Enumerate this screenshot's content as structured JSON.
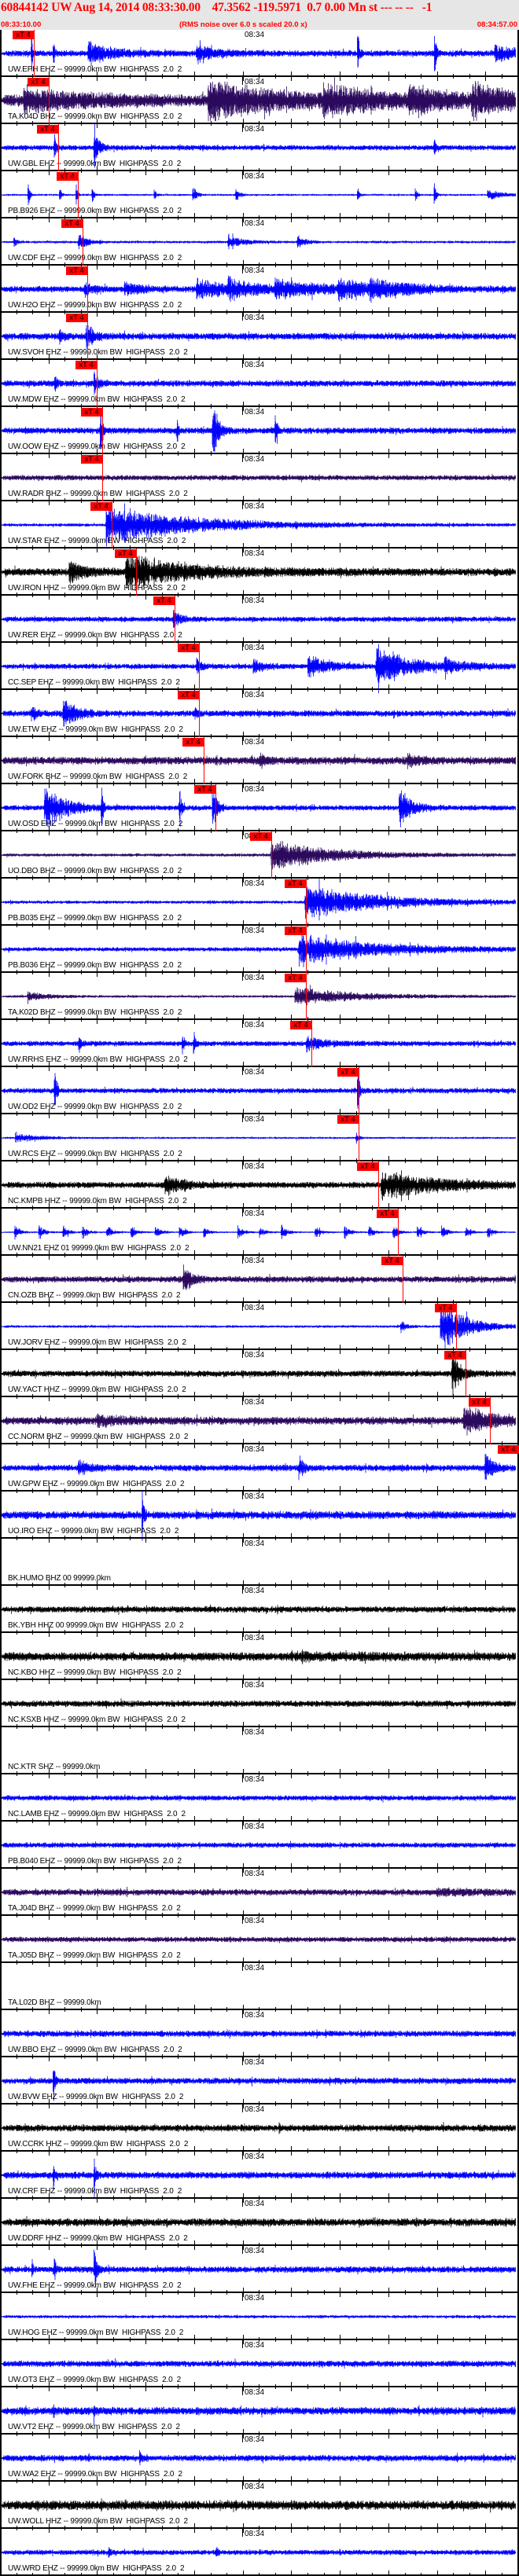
{
  "header": {
    "title": "60844142 UW Aug 14, 2014 08:33:30.00    47.3562 -119.5971  0.7 0.00 Mn st --- -- --   -1",
    "start_time": "08:33:10.00",
    "note": "(RMS noise over 6.0 s scaled 20.0 x)",
    "end_time": "08:34:57.00"
  },
  "axis": {
    "minute_label": "08:34",
    "minute_offset_s": 50
  },
  "palette": {
    "blue": "#0000ff",
    "purple": "#2b0a5e",
    "black": "#000000",
    "pick": "#ff0000"
  },
  "traces": [
    {
      "label": "UW.EPH EHZ -- 99999.0km BW  HIGHPASS  2.0  2",
      "color": "blue",
      "noise": 0.12,
      "pick": {
        "label": "xT 4",
        "time_s": 7.0
      },
      "bursts": [
        [
          6.5,
          1.2,
          0.2
        ],
        [
          11,
          1.2,
          0.2
        ],
        [
          18.2,
          0.5,
          5
        ],
        [
          40.5,
          0.4,
          4
        ],
        [
          73.7,
          1.3,
          0.3
        ],
        [
          89.6,
          1.3,
          0.3
        ],
        [
          102,
          0.4,
          4
        ]
      ]
    },
    {
      "label": "TA.K04D BHZ -- 99999.0km BW  HIGHPASS  2.0  2",
      "color": "purple",
      "noise": 0.22,
      "pick": {
        "label": "xT 4",
        "time_s": 10.0
      },
      "bursts": [
        [
          4.9,
          0.5,
          12
        ],
        [
          42.9,
          0.8,
          15
        ],
        [
          66.5,
          0.5,
          12
        ],
        [
          84.3,
          0.5,
          8
        ],
        [
          97.2,
          0.6,
          8
        ]
      ]
    },
    {
      "label": "UW.GBL EHZ -- 99999.0km BW  HIGHPASS  2.0  2",
      "color": "blue",
      "noise": 0.1,
      "pick": {
        "label": "xT 4",
        "time_s": 12.0
      },
      "bursts": [
        [
          11.2,
          0.8,
          0.4
        ],
        [
          19.4,
          1.3,
          0.8
        ],
        [
          89.5,
          0.4,
          0.3
        ]
      ]
    },
    {
      "label": "PB.B926 EHZ -- 99999.0km BW  HIGHPASS  2.0  2",
      "color": "blue",
      "noise": 0.04,
      "pick": {
        "label": "xT 4",
        "time_s": 16.0
      },
      "bursts": [
        [
          5.8,
          0.7,
          0.3
        ],
        [
          12.3,
          0.5,
          0.3
        ],
        [
          15.7,
          0.7,
          0.3
        ],
        [
          19,
          0.6,
          0.3
        ],
        [
          31.8,
          0.4,
          0.3
        ],
        [
          39.7,
          0.4,
          0.8
        ],
        [
          48.6,
          0.3,
          0.8
        ],
        [
          73.7,
          0.4,
          0.3
        ],
        [
          85.6,
          0.5,
          0.3
        ],
        [
          89.5,
          0.8,
          0.3
        ],
        [
          100.5,
          0.25,
          3
        ]
      ]
    },
    {
      "label": "UW.CDF EHZ -- 99999.0km BW  HIGHPASS  2.0  2",
      "color": "blue",
      "noise": 0.05,
      "pick": {
        "label": "xT 4",
        "time_s": 17.0
      },
      "bursts": [
        [
          2.9,
          0.4,
          0.4
        ],
        [
          16.2,
          0.5,
          1.5
        ],
        [
          47,
          0.3,
          3
        ],
        [
          61.3,
          0.3,
          1.5
        ]
      ]
    },
    {
      "label": "UW.H2O EHZ -- 99999.0km BW  HIGHPASS  2.0  2",
      "color": "blue",
      "noise": 0.12,
      "pick": {
        "label": "xT 4",
        "time_s": 18.0
      },
      "bursts": [
        [
          17.5,
          0.35,
          1.5
        ],
        [
          25.6,
          0.3,
          3
        ],
        [
          40.5,
          0.4,
          8
        ],
        [
          47,
          0.35,
          5
        ],
        [
          56.7,
          0.35,
          10
        ],
        [
          69.7,
          0.35,
          8
        ],
        [
          76.2,
          0.3,
          8
        ]
      ]
    },
    {
      "label": "UW.SVOH EHZ -- 99999.0km BW  HIGHPASS  2.0  2",
      "color": "blue",
      "noise": 0.13,
      "pick": {
        "label": "xT 4",
        "time_s": 18.0
      },
      "bursts": [
        [
          12.2,
          0.3,
          1
        ],
        [
          17.8,
          0.6,
          1.5
        ]
      ]
    },
    {
      "label": "UW.MDW EHZ -- 99999.0km BW  HIGHPASS  2.0  2",
      "color": "blue",
      "noise": 0.12,
      "pick": {
        "label": "xT 4",
        "time_s": 19.9
      },
      "bursts": [
        [
          11.3,
          0.5,
          0.4
        ],
        [
          19.4,
          0.6,
          0.8
        ]
      ]
    },
    {
      "label": "UW.OOW EHZ -- 99999.0km BW  HIGHPASS  2.0  2",
      "color": "blue",
      "noise": 0.12,
      "pick": {
        "label": "xT 4",
        "time_s": 21.1
      },
      "bursts": [
        [
          20.7,
          1.3,
          0.4
        ],
        [
          36.5,
          0.6,
          0.3
        ],
        [
          43.8,
          1.3,
          1.2
        ],
        [
          56.7,
          0.8,
          0.4
        ]
      ]
    },
    {
      "label": "UW.RADR BHZ -- 99999.0km BW  HIGHPASS  2.0  2",
      "color": "purple",
      "noise": 0.1,
      "pick": {
        "label": "xT 4",
        "time_s": 21.1
      },
      "bursts": []
    },
    {
      "label": "UW.STAR EHZ -- 99999.0km BW  HIGHPASS  2.0  2",
      "color": "blue",
      "noise": 0.06,
      "pick": {
        "label": "xT 4",
        "time_s": 23.0
      },
      "bursts": [
        [
          21.9,
          0.9,
          18
        ]
      ]
    },
    {
      "label": "UW.IRON HHZ -- 99999.0km BW  HIGHPASS  2.0  2",
      "color": "black",
      "noise": 0.15,
      "pick": {
        "label": "xT 4",
        "time_s": 28.0
      },
      "bursts": [
        [
          14.3,
          0.5,
          3
        ],
        [
          25.9,
          0.8,
          12
        ]
      ]
    },
    {
      "label": "UW.RER EHZ -- 99999.0km BW  HIGHPASS  2.0  2",
      "color": "blue",
      "noise": 0.1,
      "pick": {
        "label": "xT 4",
        "time_s": 36.0
      },
      "bursts": [
        [
          35.7,
          0.4,
          1.5
        ]
      ]
    },
    {
      "label": "CC.SEP EHZ -- 99999.0km BW  HIGHPASS  2.0  2",
      "color": "blue",
      "noise": 0.1,
      "pick": {
        "label": "xT 4",
        "time_s": 41.0
      },
      "bursts": [
        [
          40.5,
          0.4,
          1
        ],
        [
          52.2,
          0.3,
          2
        ],
        [
          63.5,
          0.5,
          4
        ],
        [
          77.5,
          1.0,
          6
        ],
        [
          91.6,
          0.3,
          4
        ]
      ]
    },
    {
      "label": "UW.ETW EHZ -- 99999.0km BW  HIGHPASS  2.0  2",
      "color": "blue",
      "noise": 0.12,
      "pick": {
        "label": "xT 4",
        "time_s": 41.0
      },
      "bursts": [
        [
          6.5,
          0.4,
          1
        ],
        [
          13,
          0.7,
          2.5
        ],
        [
          40.2,
          0.3,
          0.5
        ]
      ]
    },
    {
      "label": "UW.FORK BHZ -- 99999.0km BW  HIGHPASS  2.0  2",
      "color": "purple",
      "noise": 0.15,
      "pick": {
        "label": "xT 4",
        "time_s": 42.0
      },
      "bursts": [
        [
          53.5,
          0.3,
          1
        ],
        [
          84,
          0.3,
          2
        ]
      ]
    },
    {
      "label": "UW.OSD EHZ -- 99999.0km BW  HIGHPASS  2.0  2",
      "color": "blue",
      "noise": 0.1,
      "pick": {
        "label": "xT 4",
        "time_s": 44.4
      },
      "bursts": [
        [
          9.2,
          1.0,
          4
        ],
        [
          20.9,
          1.3,
          0.3
        ],
        [
          37,
          1.3,
          0.3
        ],
        [
          43.8,
          1.3,
          0.8
        ],
        [
          82.3,
          0.9,
          2.5
        ]
      ]
    },
    {
      "label": "UO.DBO BHZ -- 99999.0km BW  HIGHPASS  2.0  2",
      "color": "purple",
      "noise": 0.06,
      "pick": {
        "label": "xT 4",
        "time_s": 55.9
      },
      "bursts": [
        [
          55.9,
          0.7,
          12
        ]
      ]
    },
    {
      "label": "PB.B035 EHZ -- 99999.0km BW  HIGHPASS  2.0  2",
      "color": "blue",
      "noise": 0.06,
      "pick": {
        "label": "xT 4",
        "time_s": 63.0
      },
      "bursts": [
        [
          62.9,
          0.8,
          15
        ]
      ]
    },
    {
      "label": "PB.B036 EHZ -- 99999.0km BW  HIGHPASS  2.0  2",
      "color": "blue",
      "noise": 0.08,
      "pick": {
        "label": "xT 4",
        "time_s": 63.0
      },
      "bursts": [
        [
          61.6,
          0.7,
          15
        ]
      ]
    },
    {
      "label": "TA.K02D BHZ -- 99999.0km BW  HIGHPASS  2.0  2",
      "color": "purple",
      "noise": 0.05,
      "pick": {
        "label": "xT 4",
        "time_s": 63.0
      },
      "bursts": [
        [
          5.7,
          0.2,
          4
        ],
        [
          60.8,
          0.4,
          12
        ]
      ]
    },
    {
      "label": "UW.RRHS EHZ -- 99999.0km BW  HIGHPASS  2.0  2",
      "color": "blue",
      "noise": 0.1,
      "pick": {
        "label": "xT 4",
        "time_s": 64.2
      },
      "bursts": [
        [
          16.2,
          0.6,
          0.4
        ],
        [
          37.6,
          0.8,
          0.3
        ],
        [
          39.9,
          0.8,
          0.3
        ],
        [
          63.2,
          0.3,
          4
        ]
      ]
    },
    {
      "label": "UW.OD2 EHZ -- 99999.0km BW  HIGHPASS  2.0  2",
      "color": "blue",
      "noise": 0.1,
      "pick": {
        "label": "xT 4",
        "time_s": 73.9
      },
      "bursts": [
        [
          11.2,
          1.2,
          0.4
        ],
        [
          73.7,
          1.2,
          0.4
        ]
      ]
    },
    {
      "label": "UW.RCS EHZ -- 99999.0km BW  HIGHPASS  2.0  2",
      "color": "blue",
      "noise": 0.04,
      "pick": {
        "label": "xT 4",
        "time_s": 73.9
      },
      "bursts": [
        [
          3.2,
          0.2,
          5
        ],
        [
          73.4,
          0.3,
          0.5
        ]
      ]
    },
    {
      "label": "NC.KMPB HHZ -- 99999.0km BW  HIGHPASS  2.0  2",
      "color": "black",
      "noise": 0.12,
      "pick": {
        "label": "xT 4",
        "time_s": 78.0
      },
      "bursts": [
        [
          34,
          0.4,
          4
        ],
        [
          78.6,
          0.6,
          12
        ]
      ]
    },
    {
      "label": "UW.NN21 EHZ 01 99999.0km BW  HIGHPASS  2.0  2",
      "color": "blue",
      "noise": 0.03,
      "pick": {
        "label": "xT 4",
        "time_s": 82.0
      },
      "bursts": [
        [
          3,
          0.35,
          1
        ],
        [
          8,
          0.35,
          1
        ],
        [
          13,
          0.3,
          1
        ],
        [
          17,
          0.35,
          1
        ],
        [
          22,
          0.3,
          1
        ],
        [
          27,
          0.35,
          1
        ],
        [
          32,
          0.3,
          1
        ],
        [
          37,
          0.35,
          1
        ],
        [
          42,
          0.3,
          1
        ],
        [
          49,
          0.35,
          1
        ],
        [
          53.5,
          0.3,
          1
        ],
        [
          58,
          0.35,
          1
        ],
        [
          65,
          0.3,
          1
        ],
        [
          71,
          0.35,
          1
        ],
        [
          76,
          0.3,
          1
        ],
        [
          81,
          0.35,
          1
        ],
        [
          86,
          0.3,
          1
        ],
        [
          91,
          0.35,
          1
        ],
        [
          96,
          0.3,
          1
        ],
        [
          100.5,
          0.35,
          1
        ]
      ]
    },
    {
      "label": "CN.OZB BHZ -- 99999.0km BW  HIGHPASS  2.0  2",
      "color": "purple",
      "noise": 0.12,
      "pick": {
        "label": "xT 4",
        "time_s": 83.0
      },
      "bursts": [
        [
          37.8,
          0.8,
          1.5
        ]
      ]
    },
    {
      "label": "UW.JORV EHZ -- 99999.0km BW  HIGHPASS  2.0  2",
      "color": "blue",
      "noise": 0.05,
      "pick": {
        "label": "xT 4",
        "time_s": 94.0
      },
      "bursts": [
        [
          82.6,
          0.3,
          1
        ],
        [
          90.8,
          1.2,
          5
        ]
      ]
    },
    {
      "label": "UW.YACT HHZ -- 99999.0km BW  HIGHPASS  2.0  2",
      "color": "black",
      "noise": 0.12,
      "pick": {
        "label": "xT 4",
        "time_s": 95.9
      },
      "bursts": [
        [
          93.2,
          1.2,
          1.5
        ]
      ]
    },
    {
      "label": "CC.NORM BHZ -- 99999.0km BW  HIGHPASS  2.0  2",
      "color": "purple",
      "noise": 0.15,
      "pick": {
        "label": "xT 4",
        "time_s": 101.0
      },
      "bursts": [
        [
          20,
          0.2,
          5
        ],
        [
          95.6,
          0.6,
          6
        ]
      ]
    },
    {
      "label": "UW.GPW EHZ -- 99999.0km BW  HIGHPASS  2.0  2",
      "color": "blue",
      "noise": 0.12,
      "pick": {
        "label": "xT 4",
        "time_s": 106.9
      },
      "bursts": [
        [
          16.2,
          0.35,
          2
        ],
        [
          61.6,
          0.6,
          0.8
        ],
        [
          100,
          0.7,
          1.5
        ]
      ]
    },
    {
      "label": "UO.IRO EHZ -- 99999.0km BW  HIGHPASS  2.0  2",
      "color": "blue",
      "noise": 0.15,
      "pick": null,
      "bursts": [
        [
          29.3,
          1.3,
          0.3
        ]
      ]
    },
    {
      "label": "BK.HUMO BHZ 00 99999.0km",
      "color": null,
      "noise": 0,
      "pick": null,
      "bursts": []
    },
    {
      "label": "BK.YBH HHZ 00 99999.0km BW  HIGHPASS  2.0  2",
      "color": "black",
      "noise": 0.12,
      "pick": null,
      "bursts": []
    },
    {
      "label": "NC.KBO HHZ -- 99999.0km BW  HIGHPASS  2.0  2",
      "color": "black",
      "noise": 0.16,
      "pick": null,
      "bursts": [
        [
          60,
          0.1,
          15
        ]
      ]
    },
    {
      "label": "NC.KSXB HHZ -- 99999.0km BW  HIGHPASS  2.0  2",
      "color": "black",
      "noise": 0.12,
      "pick": null,
      "bursts": []
    },
    {
      "label": "NC.KTR SHZ -- 99999.0km",
      "color": null,
      "noise": 0,
      "pick": null,
      "bursts": []
    },
    {
      "label": "NC.LAMB EHZ -- 99999.0km BW  HIGHPASS  2.0  2",
      "color": "blue",
      "noise": 0.1,
      "pick": null,
      "bursts": []
    },
    {
      "label": "PB.B040 EHZ -- 99999.0km BW  HIGHPASS  2.0  2",
      "color": "blue",
      "noise": 0.1,
      "pick": null,
      "bursts": []
    },
    {
      "label": "TA.J04D BHZ -- 99999.0km BW  HIGHPASS  2.0  2",
      "color": "purple",
      "noise": 0.12,
      "pick": null,
      "bursts": [
        [
          90,
          0.1,
          15
        ]
      ]
    },
    {
      "label": "TA.J05D BHZ -- 99999.0km BW  HIGHPASS  2.0  2",
      "color": "purple",
      "noise": 0.1,
      "pick": null,
      "bursts": []
    },
    {
      "label": "TA.L02D BHZ -- 99999.0km",
      "color": null,
      "noise": 0,
      "pick": null,
      "bursts": []
    },
    {
      "label": "UW.BBO EHZ -- 99999.0km BW  HIGHPASS  2.0  2",
      "color": "blue",
      "noise": 0.12,
      "pick": null,
      "bursts": []
    },
    {
      "label": "UW.BVW EHZ -- 99999.0km BW  HIGHPASS  2.0  2",
      "color": "blue",
      "noise": 0.12,
      "pick": null,
      "bursts": [
        [
          11,
          1.2,
          0.3
        ]
      ]
    },
    {
      "label": "UW.CCRK HHZ -- 99999.0km BW  HIGHPASS  2.0  2",
      "color": "black",
      "noise": 0.13,
      "pick": null,
      "bursts": []
    },
    {
      "label": "UW.CRF EHZ -- 99999.0km BW  HIGHPASS  2.0  2",
      "color": "blue",
      "noise": 0.13,
      "pick": null,
      "bursts": [
        [
          11,
          0.9,
          0.2
        ],
        [
          19.4,
          1.2,
          0.3
        ]
      ]
    },
    {
      "label": "UW.DDRF HHZ -- 99999.0km BW  HIGHPASS  2.0  2",
      "color": "black",
      "noise": 0.15,
      "pick": null,
      "bursts": []
    },
    {
      "label": "UW.FHE EHZ -- 99999.0km BW  HIGHPASS  2.0  2",
      "color": "blue",
      "noise": 0.12,
      "pick": null,
      "bursts": [
        [
          6.6,
          0.6,
          0.2
        ],
        [
          11.2,
          1.2,
          0.2
        ],
        [
          19.4,
          1.2,
          0.5
        ]
      ]
    },
    {
      "label": "UW.HOG EHZ -- 99999.0km BW  HIGHPASS  2.0  2",
      "color": "blue",
      "noise": 0.06,
      "pick": null,
      "bursts": []
    },
    {
      "label": "UW.OT3 EHZ -- 99999.0km BW  HIGHPASS  2.0  2",
      "color": "blue",
      "noise": 0.12,
      "pick": null,
      "bursts": []
    },
    {
      "label": "UW.VT2 EHZ -- 99999.0km BW  HIGHPASS  2.0  2",
      "color": "blue",
      "noise": 0.15,
      "pick": null,
      "bursts": [
        [
          11,
          0.3,
          0.3
        ],
        [
          19.3,
          0.3,
          0.3
        ]
      ]
    },
    {
      "label": "UW.WA2 EHZ -- 99999.0km BW  HIGHPASS  2.0  2",
      "color": "blue",
      "noise": 0.12,
      "pick": null,
      "bursts": [
        [
          28.8,
          0.5,
          0.3
        ]
      ]
    },
    {
      "label": "UW.WOLL HHZ -- 99999.0km BW  HIGHPASS  2.0  2",
      "color": "black",
      "noise": 0.18,
      "pick": null,
      "bursts": []
    },
    {
      "label": "UW.WRD EHZ -- 99999.0km BW  HIGHPASS  2.0  2",
      "color": "blue",
      "noise": 0.1,
      "pick": null,
      "bursts": [
        [
          22.4,
          0.25,
          0.3
        ],
        [
          44.6,
          0.3,
          0.3
        ]
      ]
    }
  ]
}
